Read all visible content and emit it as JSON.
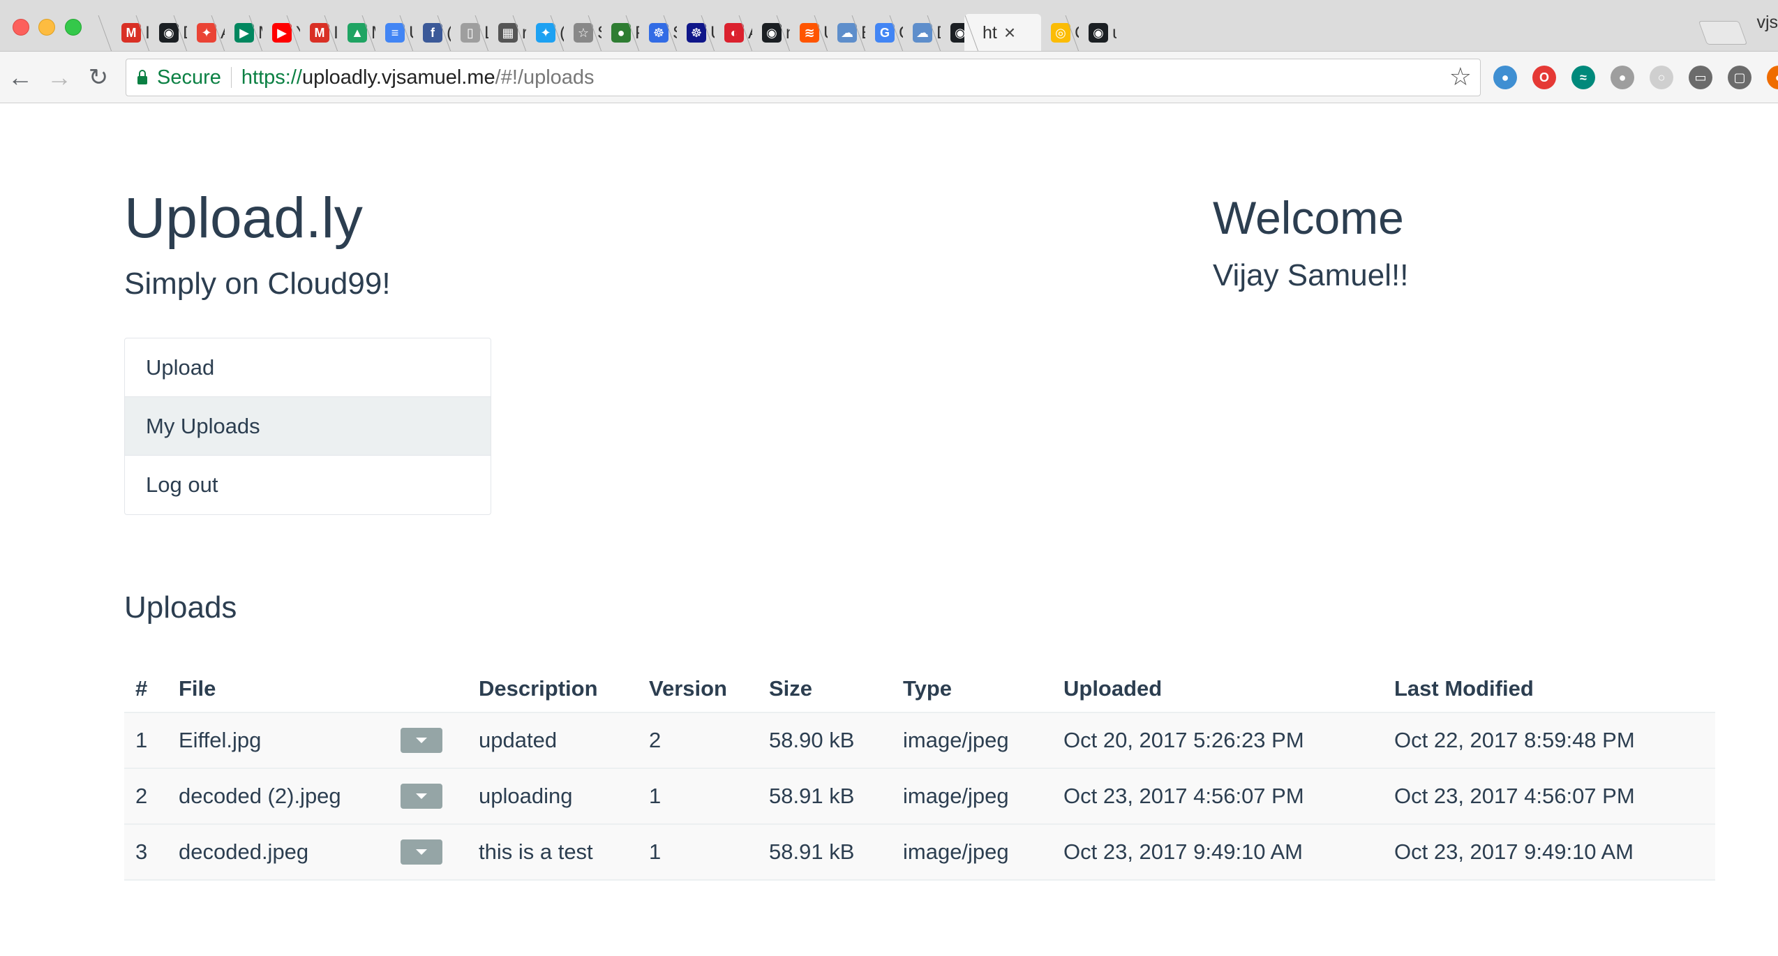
{
  "browser": {
    "tabs": [
      {
        "label": "In",
        "icon": "gmail-icon",
        "glyph": "M",
        "color": "#d93025"
      },
      {
        "label": "D",
        "icon": "github-icon",
        "glyph": "◉",
        "color": "#1b1f23"
      },
      {
        "label": "A",
        "icon": "google-photos-icon",
        "glyph": "✦",
        "color": "#ea4335"
      },
      {
        "label": "M",
        "icon": "google-play-icon",
        "glyph": "▶",
        "color": "#01875f"
      },
      {
        "label": "Y",
        "icon": "youtube-icon",
        "glyph": "▶",
        "color": "#ff0000"
      },
      {
        "label": "In",
        "icon": "gmail-icon",
        "glyph": "M",
        "color": "#d93025"
      },
      {
        "label": "M",
        "icon": "google-drive-icon",
        "glyph": "▲",
        "color": "#1fa463"
      },
      {
        "label": "U",
        "icon": "google-docs-icon",
        "glyph": "≡",
        "color": "#4285f4"
      },
      {
        "label": "(",
        "icon": "facebook-icon",
        "glyph": "f",
        "color": "#3b5998"
      },
      {
        "label": "L",
        "icon": "document-icon",
        "glyph": "▯",
        "color": "#9e9e9e"
      },
      {
        "label": "re",
        "icon": "chart-icon",
        "glyph": "▦",
        "color": "#555555"
      },
      {
        "label": "(:",
        "icon": "twitter-icon",
        "glyph": "✦",
        "color": "#1da1f2"
      },
      {
        "label": "S",
        "icon": "star-page-icon",
        "glyph": "☆",
        "color": "#888888"
      },
      {
        "label": "P",
        "icon": "globe-icon",
        "glyph": "●",
        "color": "#2e7d32"
      },
      {
        "label": "S",
        "icon": "kubernetes-icon",
        "glyph": "☸",
        "color": "#326ce5"
      },
      {
        "label": "U",
        "icon": "helm-icon",
        "glyph": "☸",
        "color": "#0f1689"
      },
      {
        "label": "A",
        "icon": "openshift-icon",
        "glyph": "◐",
        "color": "#db212e"
      },
      {
        "label": "n",
        "icon": "github-icon",
        "glyph": "◉",
        "color": "#1b1f23"
      },
      {
        "label": "U",
        "icon": "soundcloud-icon",
        "glyph": "≋",
        "color": "#ff5500"
      },
      {
        "label": "E",
        "icon": "cloud-icon",
        "glyph": "☁",
        "color": "#5e8ecb"
      },
      {
        "label": "G",
        "icon": "google-icon",
        "glyph": "G",
        "color": "#4285f4"
      },
      {
        "label": "D",
        "icon": "cloud-icon",
        "glyph": "☁",
        "color": "#5e8ecb"
      },
      {
        "label": "u",
        "icon": "github-icon",
        "glyph": "◉",
        "color": "#1b1f23"
      },
      {
        "label": "ht",
        "icon": "",
        "glyph": "",
        "color": "",
        "active": true
      },
      {
        "label": "C",
        "icon": "chrome-icon",
        "glyph": "◎",
        "color": "#fbbc05"
      },
      {
        "label": "u",
        "icon": "github-icon",
        "glyph": "◉",
        "color": "#1b1f23"
      }
    ],
    "profile_label": "vjs",
    "close_glyph": "×",
    "secure_label": "Secure",
    "url_scheme": "https://",
    "url_host": "uploadly.vjsamuel.me",
    "url_path": "/#!/uploads",
    "extensions": [
      {
        "name": "globe-extension-icon",
        "glyph": "●",
        "color": "#3f8fd2"
      },
      {
        "name": "opera-extension-icon",
        "glyph": "O",
        "color": "#e53935"
      },
      {
        "name": "wave-extension-icon",
        "glyph": "≈",
        "color": "#00897b"
      },
      {
        "name": "circle-extension-icon",
        "glyph": "●",
        "color": "#9e9e9e"
      },
      {
        "name": "ring-extension-icon",
        "glyph": "○",
        "color": "#cfcfcf"
      },
      {
        "name": "cast-icon",
        "glyph": "▭",
        "color": "#6b6b6b"
      },
      {
        "name": "square-extension-icon",
        "glyph": "▢",
        "color": "#6b6b6b"
      },
      {
        "name": "orange-extension-icon",
        "glyph": "●",
        "color": "#ef6c00"
      }
    ]
  },
  "brand": {
    "title": "Upload.ly",
    "subtitle": "Simply on Cloud99!"
  },
  "welcome": {
    "title": "Welcome",
    "name": "Vijay Samuel!!"
  },
  "menu": {
    "items": [
      {
        "label": "Upload",
        "active": false
      },
      {
        "label": "My Uploads",
        "active": true
      },
      {
        "label": "Log out",
        "active": false
      }
    ]
  },
  "uploads": {
    "heading": "Uploads",
    "columns": {
      "num": "#",
      "file": "File",
      "description": "Description",
      "version": "Version",
      "size": "Size",
      "type": "Type",
      "uploaded": "Uploaded",
      "modified": "Last Modified"
    },
    "rows": [
      {
        "num": "1",
        "file": "Eiffel.jpg",
        "description": "updated",
        "version": "2",
        "size": "58.90 kB",
        "type": "image/jpeg",
        "uploaded": "Oct 20, 2017 5:26:23 PM",
        "modified": "Oct 22, 2017 8:59:48 PM"
      },
      {
        "num": "2",
        "file": "decoded (2).jpeg",
        "description": "uploading",
        "version": "1",
        "size": "58.91 kB",
        "type": "image/jpeg",
        "uploaded": "Oct 23, 2017 4:56:07 PM",
        "modified": "Oct 23, 2017 4:56:07 PM"
      },
      {
        "num": "3",
        "file": "decoded.jpeg",
        "description": "this is a test",
        "version": "1",
        "size": "58.91 kB",
        "type": "image/jpeg",
        "uploaded": "Oct 23, 2017 9:49:10 AM",
        "modified": "Oct 23, 2017 9:49:10 AM"
      }
    ]
  }
}
